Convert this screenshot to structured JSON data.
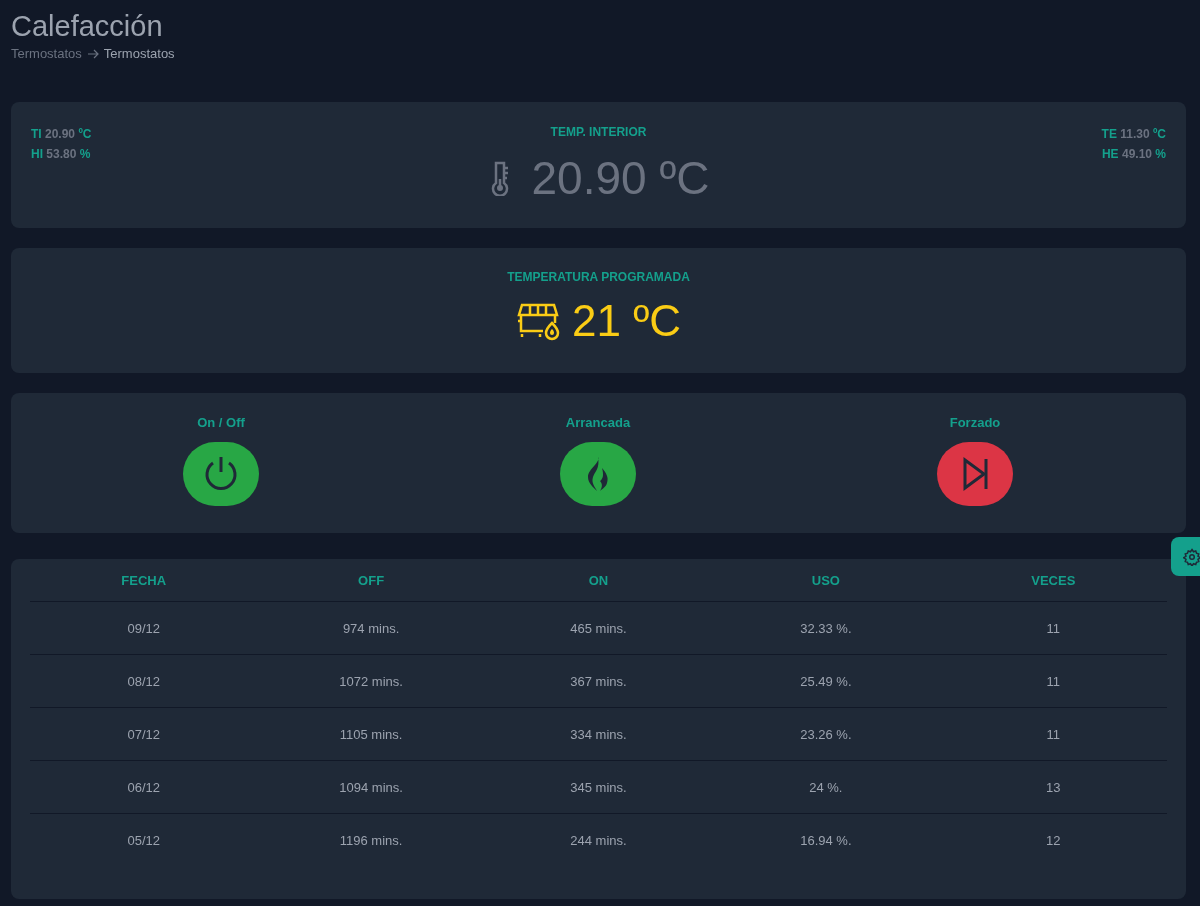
{
  "page": {
    "title": "Calefacción",
    "breadcrumb": [
      "Termostatos",
      "Termostatos"
    ]
  },
  "interior": {
    "label": "TEMP. INTERIOR",
    "value": "20.90 ºC",
    "left": [
      {
        "key": "TI",
        "value": "20.90",
        "unit": "ºC"
      },
      {
        "key": "HI",
        "value": "53.80",
        "unit": "%"
      }
    ],
    "right": [
      {
        "key": "TE",
        "value": "11.30",
        "unit": "ºC"
      },
      {
        "key": "HE",
        "value": "49.10",
        "unit": "%"
      }
    ]
  },
  "programmed": {
    "label": "TEMPERATURA PROGRAMADA",
    "value": "21 ºC"
  },
  "controls": [
    {
      "kind": "power",
      "label": "On / Off",
      "on": true
    },
    {
      "kind": "flame",
      "label": "Arrancada",
      "on": true
    },
    {
      "kind": "skip",
      "label": "Forzado",
      "on": false
    }
  ],
  "table": {
    "columns": [
      "FECHA",
      "OFF",
      "ON",
      "USO",
      "VECES"
    ],
    "rows": [
      [
        "09/12",
        "974 mins.",
        "465 mins.",
        "32.33 %.",
        "11"
      ],
      [
        "08/12",
        "1072 mins.",
        "367 mins.",
        "25.49 %.",
        "11"
      ],
      [
        "07/12",
        "1105 mins.",
        "334 mins.",
        "23.26 %.",
        "11"
      ],
      [
        "06/12",
        "1094 mins.",
        "345 mins.",
        "24 %.",
        "13"
      ],
      [
        "05/12",
        "1196 mins.",
        "244 mins.",
        "16.94 %.",
        "12"
      ]
    ]
  }
}
